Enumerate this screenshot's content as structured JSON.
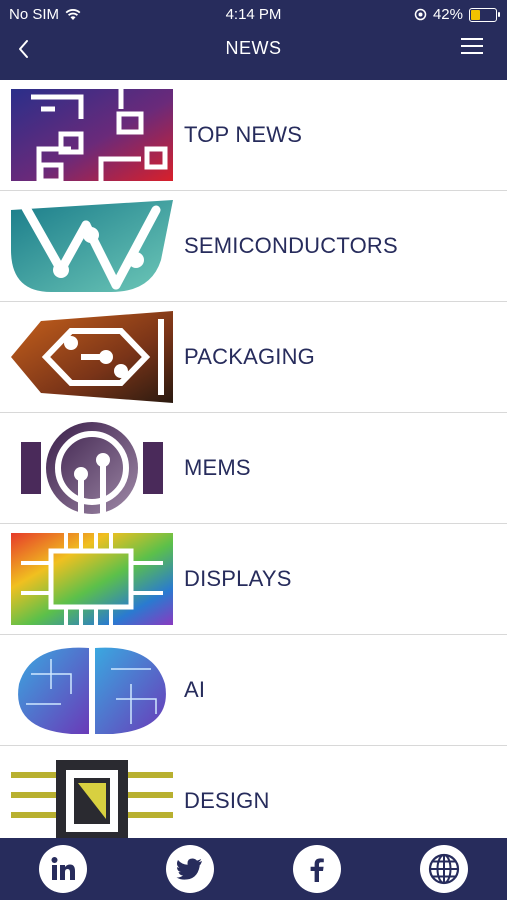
{
  "status_bar": {
    "carrier": "No SIM",
    "time": "4:14 PM",
    "battery": "42%",
    "battery_level": 0.42
  },
  "header": {
    "title": "NEWS"
  },
  "categories": [
    {
      "label": "TOP NEWS",
      "icon": "circuit-board-icon"
    },
    {
      "label": "SEMICONDUCTORS",
      "icon": "semiconductor-icon"
    },
    {
      "label": "PACKAGING",
      "icon": "packaging-icon"
    },
    {
      "label": "MEMS",
      "icon": "mems-icon"
    },
    {
      "label": "DISPLAYS",
      "icon": "displays-icon"
    },
    {
      "label": "AI",
      "icon": "ai-brain-icon"
    },
    {
      "label": "DESIGN",
      "icon": "design-chip-icon"
    }
  ],
  "footer": {
    "icons": [
      "linkedin-icon",
      "twitter-icon",
      "facebook-icon",
      "globe-icon"
    ]
  },
  "colors": {
    "brand": "#272c5c",
    "battery_fill": "#f2c200",
    "divider": "#d8d8d8"
  }
}
